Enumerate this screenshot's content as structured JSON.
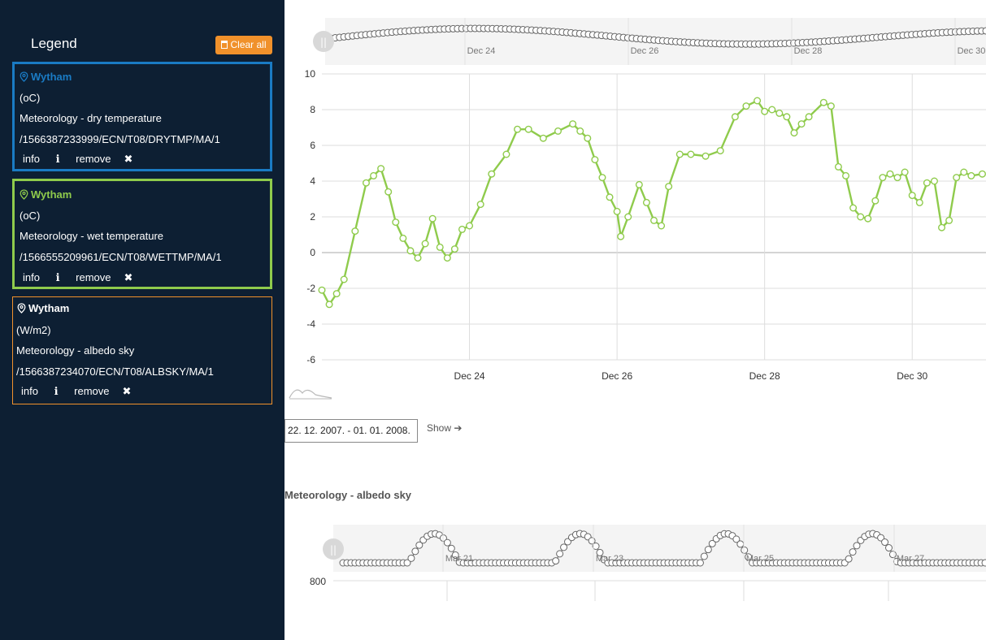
{
  "legend": {
    "title": "Legend",
    "clear_all": "Clear all",
    "cards": [
      {
        "location": "Wytham",
        "unit": "(oC)",
        "name": "Meteorology - dry temperature",
        "id": "/1566387233999/ECN/T08/DRYTMP/MA/1",
        "info": "info",
        "remove": "remove",
        "color": "#1a7bc4",
        "text_color": "#ffffff"
      },
      {
        "location": "Wytham",
        "unit": "(oC)",
        "name": "Meteorology - wet temperature",
        "id": "/1566555209961/ECN/T08/WETTMP/MA/1",
        "info": "info",
        "remove": "remove",
        "color": "#8fcb4c",
        "text_color": "#ffffff"
      },
      {
        "location": "Wytham",
        "unit": "(W/m2)",
        "name": "Meteorology - albedo sky",
        "id": "/1566387234070/ECN/T08/ALBSKY/MA/1",
        "info": "info",
        "remove": "remove",
        "color": "#f0912b",
        "text_color": "#ffffff"
      }
    ]
  },
  "colors": {
    "sidebar_bg": "#0d1f33",
    "accent_orange": "#f0912b",
    "series_green": "#8fcb4c",
    "navigator_grey": "#666666"
  },
  "date_range": {
    "value": "22. 12. 2007. - 01. 01. 2008.",
    "show_label": "Show"
  },
  "chart_data": [
    {
      "type": "line",
      "title": "",
      "xlabel": "",
      "ylabel": "",
      "x_unit": "day (Dec 2007)",
      "xlim": [
        22.0,
        31.0
      ],
      "ylim": [
        -6,
        10
      ],
      "y_ticks": [
        -6,
        -4,
        -2,
        0,
        2,
        4,
        6,
        8,
        10
      ],
      "x_ticks": [
        {
          "x": 24,
          "label": "Dec 24"
        },
        {
          "x": 26,
          "label": "Dec 26"
        },
        {
          "x": 28,
          "label": "Dec 28"
        },
        {
          "x": 30,
          "label": "Dec 30"
        }
      ],
      "navigator_ticks": [
        "Dec 24",
        "Dec 26",
        "Dec 28",
        "Dec 30"
      ],
      "grid": true,
      "series": [
        {
          "color": "#8fcb4c",
          "x": [
            22.0,
            22.1,
            22.2,
            22.3,
            22.45,
            22.6,
            22.7,
            22.8,
            22.9,
            23.0,
            23.1,
            23.2,
            23.3,
            23.4,
            23.5,
            23.6,
            23.7,
            23.8,
            23.9,
            24.0,
            24.15,
            24.3,
            24.5,
            24.65,
            24.8,
            25.0,
            25.2,
            25.4,
            25.5,
            25.6,
            25.7,
            25.8,
            25.9,
            26.0,
            26.05,
            26.15,
            26.3,
            26.4,
            26.5,
            26.6,
            26.7,
            26.85,
            27.0,
            27.2,
            27.4,
            27.6,
            27.75,
            27.9,
            28.0,
            28.1,
            28.2,
            28.3,
            28.4,
            28.5,
            28.6,
            28.8,
            28.9,
            29.0,
            29.1,
            29.2,
            29.3,
            29.4,
            29.5,
            29.6,
            29.7,
            29.8,
            29.9,
            30.0,
            30.1,
            30.2,
            30.3,
            30.4,
            30.5,
            30.6,
            30.7,
            30.8,
            30.95
          ],
          "y": [
            -2.1,
            -2.9,
            -2.3,
            -1.5,
            1.2,
            3.9,
            4.3,
            4.7,
            3.4,
            1.7,
            0.8,
            0.1,
            -0.3,
            0.5,
            1.9,
            0.3,
            -0.3,
            0.2,
            1.3,
            1.5,
            2.7,
            4.4,
            5.5,
            6.9,
            6.9,
            6.4,
            6.8,
            7.2,
            6.8,
            6.4,
            5.2,
            4.2,
            3.1,
            2.3,
            0.9,
            2.0,
            3.8,
            2.8,
            1.8,
            1.5,
            3.7,
            5.5,
            5.5,
            5.4,
            5.7,
            7.6,
            8.2,
            8.5,
            7.9,
            8.0,
            7.8,
            7.6,
            6.7,
            7.2,
            7.6,
            8.4,
            8.2,
            4.8,
            4.3,
            2.5,
            2.0,
            1.9,
            2.9,
            4.2,
            4.4,
            4.2,
            4.5,
            3.2,
            2.8,
            3.9,
            4.0,
            1.4,
            1.8,
            4.2,
            4.5,
            4.3,
            4.4
          ]
        },
        {
          "role": "navigator",
          "color": "#666666"
        }
      ]
    },
    {
      "type": "line",
      "title": "Meteorology - albedo sky",
      "xlabel": "",
      "ylabel": "",
      "y_ticks": [
        800
      ],
      "navigator_ticks": [
        "Mar 21",
        "Mar 23",
        "Mar 25",
        "Mar 27"
      ],
      "grid": true,
      "series": [
        {
          "role": "navigator",
          "color": "#666666"
        }
      ]
    }
  ]
}
